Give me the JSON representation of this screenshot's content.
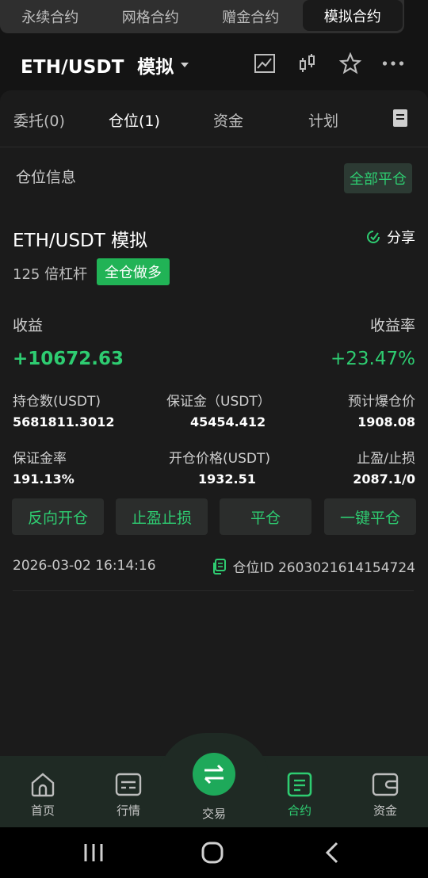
{
  "top_tabs": [
    "永续合约",
    "网格合约",
    "赠金合约",
    "模拟合约"
  ],
  "header": {
    "pair": "ETH/USDT",
    "mode": "模拟"
  },
  "sub_tabs": [
    "委托(0)",
    "仓位(1)",
    "资金",
    "计划"
  ],
  "section": {
    "title": "仓位信息",
    "close_all": "全部平仓"
  },
  "position": {
    "title": "ETH/USDT 模拟",
    "share": "分享",
    "leverage": "125 倍杠杆",
    "side_badge": "全仓做多",
    "pnl_label": "收益",
    "pnl_value": "+10672.63",
    "roi_label": "收益率",
    "roi_value": "+23.47%",
    "stats": [
      {
        "label": "持仓数(USDT)",
        "value": "5681811.3012"
      },
      {
        "label": "保证金（USDT）",
        "value": "45454.412"
      },
      {
        "label": "预计爆仓价",
        "value": "1908.08"
      },
      {
        "label": "保证金率",
        "value": "191.13%"
      },
      {
        "label": "开仓价格(USDT)",
        "value": "1932.51"
      },
      {
        "label": "止盈/止损",
        "value": "2087.1/0"
      }
    ],
    "actions": [
      "反向开仓",
      "止盈止损",
      "平仓",
      "一键平仓"
    ],
    "time": "2026-03-02 16:14:16",
    "position_id": "仓位ID 2603021614154724"
  },
  "bottom_nav": [
    "首页",
    "行情",
    "交易",
    "合约",
    "资金"
  ],
  "colors": {
    "accent": "#2ecc71",
    "badge": "#21b356",
    "background": "#141414"
  }
}
